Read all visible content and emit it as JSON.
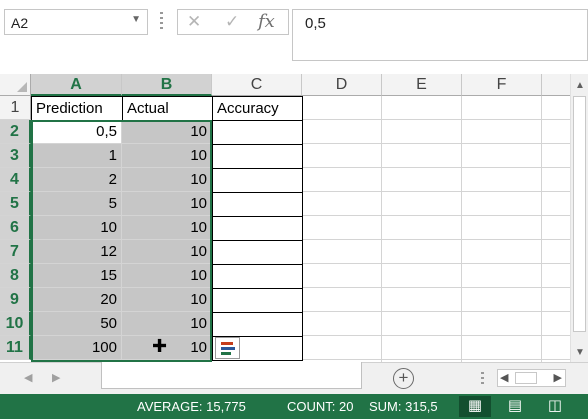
{
  "name_box": {
    "value": "A2"
  },
  "formula_bar": {
    "cancel_icon": "✕",
    "enter_icon": "✓",
    "function_label": "fx",
    "value": "0,5"
  },
  "columns": [
    "A",
    "B",
    "C",
    "D",
    "E",
    "F"
  ],
  "rows": [
    "1",
    "2",
    "3",
    "4",
    "5",
    "6",
    "7",
    "8",
    "9",
    "10",
    "11"
  ],
  "header_row": {
    "A": "Prediction",
    "B": "Actual",
    "C": "Accuracy"
  },
  "data_rows": [
    {
      "A": "0,5",
      "B": "10",
      "C": ""
    },
    {
      "A": "1",
      "B": "10",
      "C": ""
    },
    {
      "A": "2",
      "B": "10",
      "C": ""
    },
    {
      "A": "5",
      "B": "10",
      "C": ""
    },
    {
      "A": "10",
      "B": "10",
      "C": ""
    },
    {
      "A": "12",
      "B": "10",
      "C": ""
    },
    {
      "A": "15",
      "B": "10",
      "C": ""
    },
    {
      "A": "20",
      "B": "10",
      "C": ""
    },
    {
      "A": "50",
      "B": "10",
      "C": ""
    },
    {
      "A": "100",
      "B": "10",
      "C": ""
    }
  ],
  "sheet_tabs": {
    "add_icon": "+"
  },
  "status_bar": {
    "average": "AVERAGE: 15,775",
    "count": "COUNT: 20",
    "sum": "SUM: 315,5"
  },
  "colors": {
    "accent": "#217346",
    "selection_fill": "#c6c6c6",
    "header_fill": "#f3f3f3"
  }
}
